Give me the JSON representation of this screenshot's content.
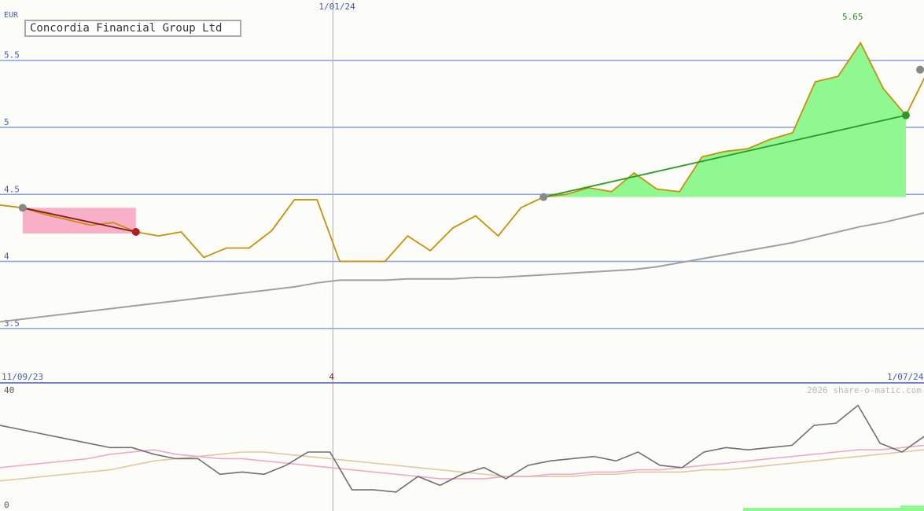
{
  "chart_data": [
    {
      "type": "line",
      "title": "Concordia Financial Group Ltd",
      "currency": "EUR",
      "ylim": [
        3.1,
        5.95
      ],
      "y_ticks": [
        3.5,
        4,
        4.5,
        5,
        5.5
      ],
      "date_labels": {
        "start": "11/09/23",
        "mid": "1/01/24",
        "end": "1/07/24"
      },
      "max_label": "5.65",
      "credit": "2026 share-o-matic.com",
      "colors": {
        "price": "#c8900a",
        "ma": "#a0a0a0",
        "rise": "#90f890",
        "fall": "#f8b0c8",
        "trend_up": "#2a9a2a",
        "trend_down": "#8b1a1a",
        "grid": "#8aa0e0"
      },
      "price": [
        4.42,
        4.4,
        4.35,
        4.31,
        4.27,
        4.29,
        4.22,
        4.19,
        4.22,
        4.03,
        4.1,
        4.1,
        4.23,
        4.46,
        4.46,
        4.0,
        4.0,
        4.0,
        4.19,
        4.08,
        4.25,
        4.34,
        4.19,
        4.4,
        4.48,
        4.5,
        4.55,
        4.52,
        4.66,
        4.54,
        4.52,
        4.78,
        4.82,
        4.84,
        4.91,
        4.96,
        5.34,
        5.38,
        5.63,
        5.29,
        5.09,
        5.43
      ],
      "moving_average": [
        3.55,
        3.57,
        3.59,
        3.61,
        3.63,
        3.65,
        3.67,
        3.69,
        3.71,
        3.73,
        3.75,
        3.77,
        3.79,
        3.81,
        3.84,
        3.86,
        3.86,
        3.86,
        3.87,
        3.87,
        3.87,
        3.88,
        3.88,
        3.89,
        3.9,
        3.91,
        3.92,
        3.93,
        3.94,
        3.96,
        3.99,
        4.02,
        4.05,
        4.08,
        4.11,
        4.14,
        4.18,
        4.22,
        4.26,
        4.29,
        4.33,
        4.37
      ],
      "down_trend": {
        "from": 1,
        "to": 6,
        "from_value": 4.4,
        "to_value": 4.22
      },
      "up_trend": {
        "from": 24,
        "to": 40,
        "from_value": 4.48,
        "to_value": 5.09
      }
    },
    {
      "type": "line",
      "y_ticks": [
        "40",
        "0"
      ],
      "x_label": "4",
      "series": [
        {
          "color": "#707070",
          "values": [
            35,
            33,
            31,
            29,
            27,
            25,
            25,
            22,
            20,
            20,
            13,
            14,
            13,
            17,
            23,
            23,
            6,
            6,
            5,
            12,
            8,
            13,
            16,
            11,
            17,
            19,
            20,
            21,
            19,
            23,
            17,
            16,
            23,
            25,
            24,
            25,
            26,
            35,
            36,
            44,
            27,
            23,
            30
          ]
        },
        {
          "color": "#f0a8c8",
          "values": [
            16,
            17,
            18,
            19,
            20,
            22,
            23,
            24,
            22,
            21,
            20,
            20,
            19,
            18,
            17,
            16,
            15,
            14,
            13,
            12,
            11,
            11,
            11,
            12,
            12,
            13,
            13,
            14,
            14,
            15,
            15,
            16,
            17,
            18,
            19,
            20,
            21,
            22,
            23,
            24,
            24,
            25,
            26
          ]
        },
        {
          "color": "#e0c8a0",
          "values": [
            10,
            11,
            12,
            13,
            14,
            15,
            17,
            19,
            20,
            21,
            22,
            23,
            23,
            22,
            21,
            20,
            19,
            18,
            17,
            16,
            15,
            14,
            13,
            12,
            12,
            12,
            12,
            13,
            13,
            14,
            14,
            14,
            15,
            15,
            16,
            17,
            18,
            19,
            20,
            21,
            22,
            23,
            24
          ]
        }
      ]
    }
  ]
}
